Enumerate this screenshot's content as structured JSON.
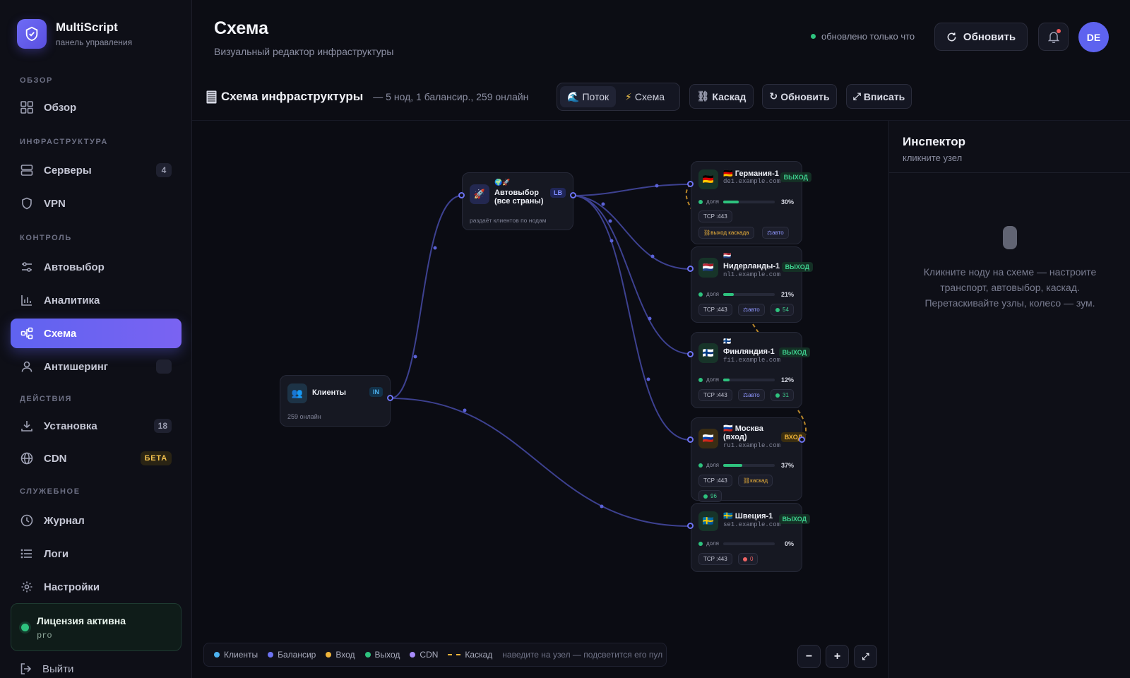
{
  "brand": {
    "title": "MultiScript",
    "subtitle": "панель управления"
  },
  "sidebar": {
    "sections": {
      "overview": "ОБЗОР",
      "infrastructure": "ИНФРАСТРУКТУРА",
      "control": "КОНТРОЛЬ",
      "actions": "ДЕЙСТВИЯ",
      "service": "СЛУЖЕБНОЕ"
    },
    "items": [
      {
        "label": "Обзор",
        "icon": "grid-icon"
      },
      {
        "label": "Серверы",
        "icon": "server-icon",
        "badge": "4"
      },
      {
        "label": "VPN",
        "icon": "shield-icon"
      },
      {
        "label": "Автовыбор",
        "icon": "sliders-icon"
      },
      {
        "label": "Аналитика",
        "icon": "bar-chart-icon"
      },
      {
        "label": "Схема",
        "icon": "schema-icon",
        "active": true
      },
      {
        "label": "Антишеринг",
        "icon": "user-icon"
      },
      {
        "label": "Установка",
        "icon": "download-icon",
        "badge": "18"
      },
      {
        "label": "CDN",
        "icon": "globe-icon",
        "badge": "БЕТА"
      },
      {
        "label": "Журнал",
        "icon": "clock-icon"
      },
      {
        "label": "Логи",
        "icon": "list-icon"
      },
      {
        "label": "Настройки",
        "icon": "gear-icon"
      }
    ],
    "license": {
      "title": "Лицензия активна",
      "plan": "pro"
    },
    "logout": "Выйти"
  },
  "header": {
    "title": "Схема",
    "subtitle": "Визуальный редактор инфраструктуры",
    "status": "обновлено только что",
    "refresh": "Обновить",
    "avatar": "DE"
  },
  "toolbar": {
    "title": "Схема инфраструктуры",
    "meta": "— 5 нод, 1 балансир., 259 онлайн",
    "mode_flow": "Поток",
    "mode_schema": "Схема",
    "cascade": "Каскад",
    "refresh": "Обновить",
    "fit": "Вписать"
  },
  "nodes": {
    "clients": {
      "title": "Клиенты",
      "tag": "IN",
      "sub": "259 онлайн"
    },
    "balancer": {
      "title_line1": "Автовыбор",
      "title_line2": "(все страны)",
      "tag": "LB",
      "sub": "раздаёт клиентов по нодам"
    },
    "de": {
      "title": "Германия-1",
      "host": "de1.example.com",
      "tag": "ВЫХОД",
      "share_label": "доля",
      "share": "30%",
      "share_value": 30,
      "port": "TCP :443",
      "chip_cascade": "выход каскада",
      "chip_auto": "авто"
    },
    "nl": {
      "title": "Нидерланды-1",
      "host": "nl1.example.com",
      "tag": "ВЫХОД",
      "share_label": "доля",
      "share": "21%",
      "share_value": 21,
      "port": "TCP :443",
      "chip_auto": "авто",
      "online": "54"
    },
    "fi": {
      "title": "Финляндия-1",
      "host": "fi1.example.com",
      "tag": "ВЫХОД",
      "share_label": "доля",
      "share": "12%",
      "share_value": 12,
      "port": "TCP :443",
      "chip_auto": "авто",
      "online": "31"
    },
    "ru": {
      "title_line1": "Москва",
      "title_line2": "(вход)",
      "host": "ru1.example.com",
      "tag": "ВХОД",
      "share_label": "доля",
      "share": "37%",
      "share_value": 37,
      "port": "TCP :443",
      "chip_cascade": "каскад",
      "online": "96"
    },
    "se": {
      "title": "Швеция-1",
      "host": "se1.example.com",
      "tag": "ВЫХОД",
      "share_label": "доля",
      "share": "0%",
      "share_value": 0,
      "port": "TCP :443",
      "online": "0"
    }
  },
  "legend": {
    "clients": "Клиенты",
    "balancer": "Балансир",
    "entry": "Вход",
    "exit": "Выход",
    "cdn": "CDN",
    "cascade": "Каскад",
    "hint": "наведите на узел — подсветится его пул"
  },
  "colors": {
    "accent": "#5f63f0",
    "green": "#2ec27e",
    "amber": "#f0b43a",
    "edge": "#3d4190"
  },
  "inspector": {
    "title": "Инспектор",
    "subtitle": "кликните узел",
    "empty_text": "Кликните ноду на схеме — настроите транспорт, автовыбор, каскад. Перетаскивайте узлы, колесо — зум."
  }
}
